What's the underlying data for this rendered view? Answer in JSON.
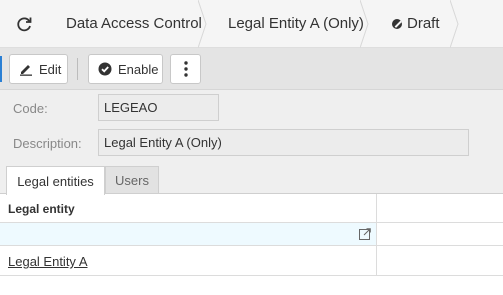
{
  "breadcrumb": {
    "items": [
      "Data Access Control",
      "Legal Entity A (Only)",
      "Draft"
    ]
  },
  "toolbar": {
    "edit_label": "Edit",
    "enable_label": "Enable"
  },
  "form": {
    "code_label": "Code:",
    "code_value": "LEGEAO",
    "description_label": "Description:",
    "description_value": "Legal Entity A (Only)"
  },
  "tabs": [
    "Legal entities",
    "Users"
  ],
  "grid": {
    "columns": [
      "Legal entity"
    ],
    "rows": [
      {
        "legal_entity": "Legal Entity A"
      }
    ]
  },
  "colors": {
    "accent": "#2a7fd4",
    "filter_row": "#eefaff"
  }
}
